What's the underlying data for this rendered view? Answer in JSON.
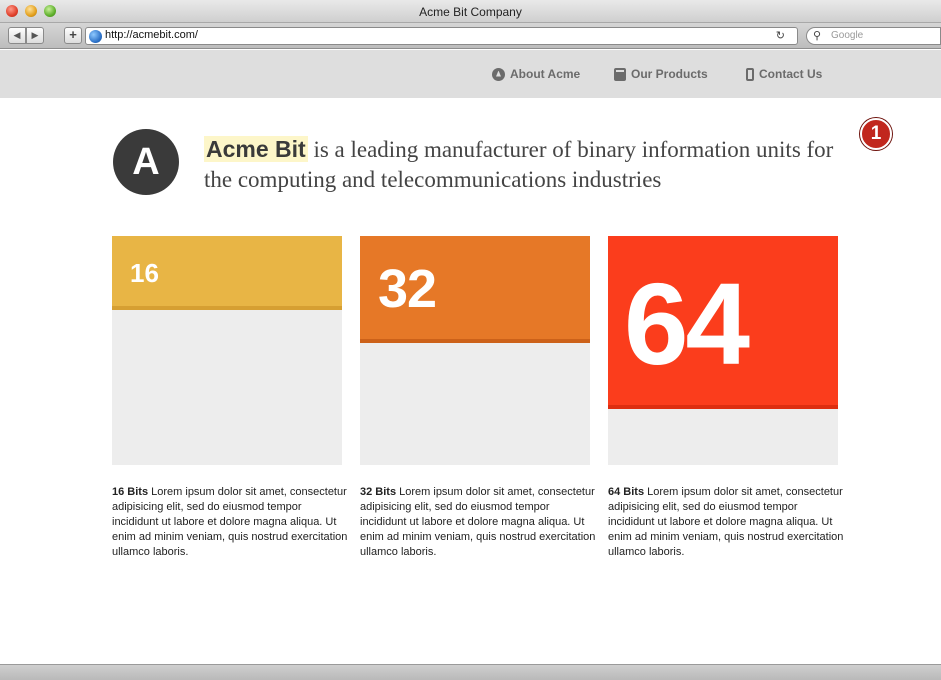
{
  "window": {
    "title": "Acme Bit Company"
  },
  "browser": {
    "url": "http://acmebit.com/",
    "search_placeholder": "Google",
    "add_label": "+"
  },
  "nav": {
    "items": [
      {
        "label": "About Acme",
        "icon": "info-circle-icon"
      },
      {
        "label": "Our Products",
        "icon": "box-icon"
      },
      {
        "label": "Contact Us",
        "icon": "phone-icon"
      }
    ]
  },
  "hero": {
    "logo_letter": "A",
    "brand": "Acme Bit",
    "tagline": " is a leading manufacturer of binary information units for the computing and telecommunications industries"
  },
  "annotation_badge": "1",
  "cards": [
    {
      "number": "16",
      "title": "16 Bits",
      "body": " Lorem ipsum dolor sit amet, consectetur adipisicing elit, sed do eiusmod tempor incididunt ut labore et dolore magna aliqua. Ut enim ad minim veniam, quis nostrud exercitation ullamco laboris.",
      "color": "#e8b545"
    },
    {
      "number": "32",
      "title": "32 Bits",
      "body": " Lorem ipsum dolor sit amet, consectetur adipisicing elit, sed do eiusmod tempor incididunt ut labore et dolore magna aliqua. Ut enim ad minim veniam, quis nostrud exercitation ullamco laboris.",
      "color": "#e67827"
    },
    {
      "number": "64",
      "title": "64 Bits",
      "body": " Lorem ipsum dolor sit amet, consectetur adipisicing elit, sed do eiusmod tempor incididunt ut labore et dolore magna aliqua. Ut enim ad minim veniam, quis nostrud exercitation ullamco laboris.",
      "color": "#fb3d1c"
    }
  ]
}
